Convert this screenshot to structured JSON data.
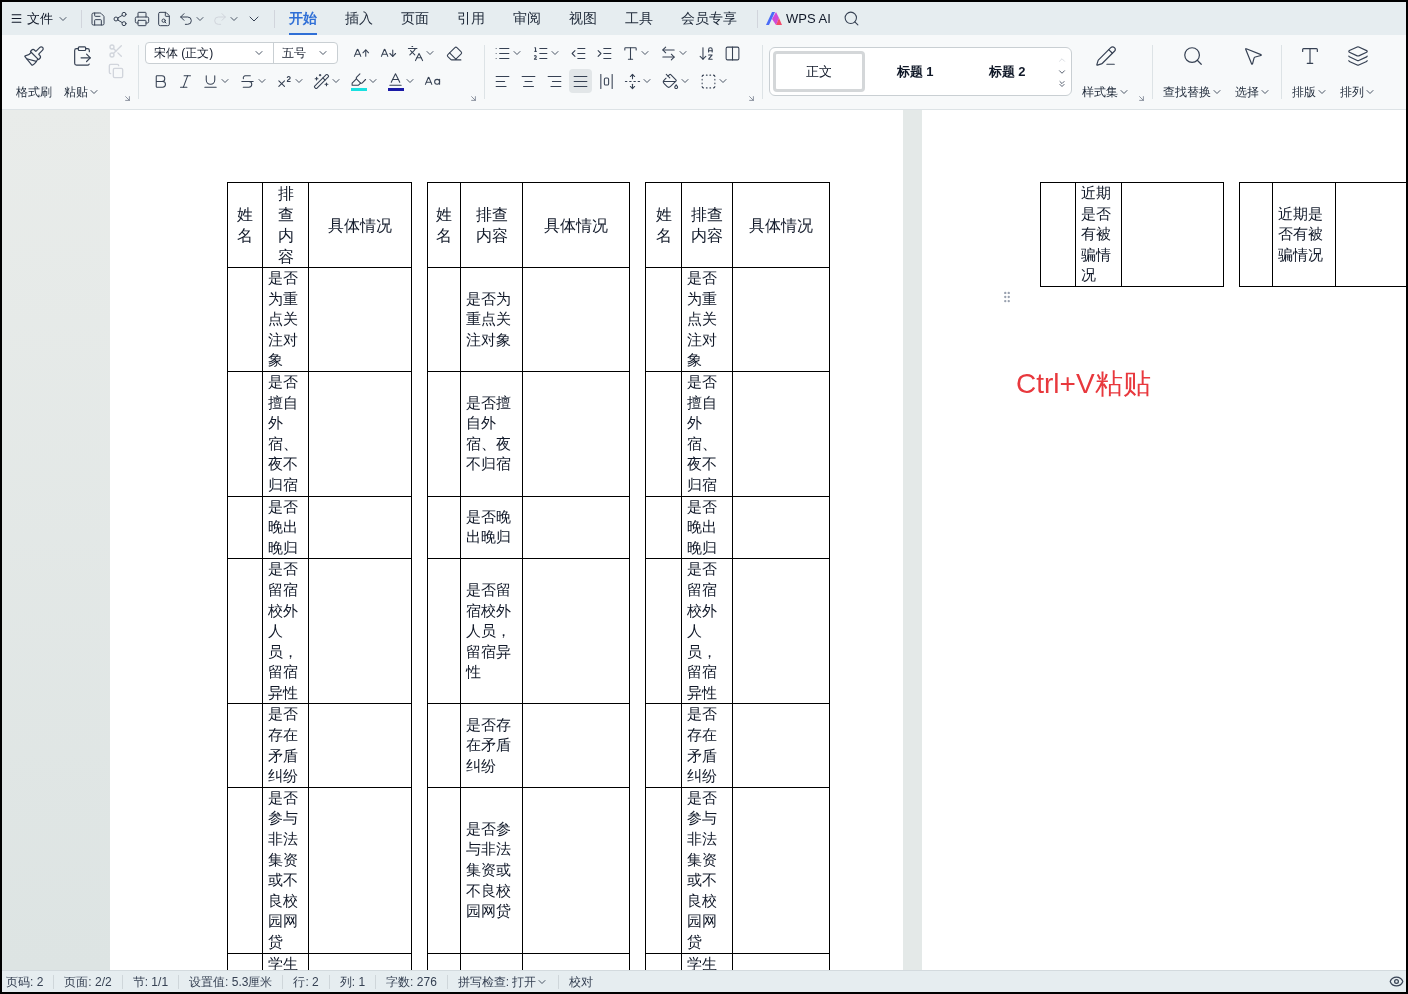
{
  "menu": {
    "label": "文件"
  },
  "quick_access": {
    "redo": {
      "disabled": true
    }
  },
  "ribbon_tabs": [
    {
      "label": "开始",
      "selected": true
    },
    {
      "label": "插入",
      "selected": false
    },
    {
      "label": "页面",
      "selected": false
    },
    {
      "label": "引用",
      "selected": false
    },
    {
      "label": "审阅",
      "selected": false
    },
    {
      "label": "视图",
      "selected": false
    },
    {
      "label": "工具",
      "selected": false
    },
    {
      "label": "会员专享",
      "selected": false
    }
  ],
  "wps_ai": "WPS AI",
  "ribbon": {
    "format_painter": "格式刷",
    "paste": "粘贴",
    "cut": {
      "disabled": true
    },
    "copy": {
      "disabled": true
    },
    "font_name": "宋体 (正文)",
    "font_size": "五号",
    "styles": [
      {
        "label": "正文",
        "selected": true
      },
      {
        "label": "标题 1",
        "selected": false
      },
      {
        "label": "标题 2",
        "selected": false
      }
    ],
    "style_set": "样式集",
    "find_replace": "查找替换",
    "select": "选择",
    "layout": "排版",
    "arrange": "排列"
  },
  "page1": {
    "tables": [
      {
        "header": [
          "姓名",
          "排查内容",
          "具体情况"
        ],
        "items": [
          "是否为重点关注对象",
          "是否擅自外宿、夜不归宿",
          "是否晚出晚归",
          "是否留宿校外人员，留宿异性",
          "是否存在矛盾纠纷",
          "是否参与非法集资或不良校园网贷",
          "学生"
        ]
      },
      {
        "header": [
          "姓名",
          "排查内容",
          "具体情况"
        ],
        "items": [
          "是否为重点关注对象",
          "是否擅自外宿、夜不归宿",
          "是否晚出晚归",
          "是否留宿校外人员，留宿异性",
          "是否存在矛盾纠纷",
          "是否参与非法集资或不良校园网贷"
        ]
      },
      {
        "header": [
          "姓名",
          "排查内容",
          "具体情况"
        ],
        "items": [
          "是否为重点关注对象",
          "是否擅自外宿、夜不归宿",
          "是否晚出晚归",
          "是否留宿校外人员，留宿异性",
          "是否存在矛盾纠纷",
          "是否参与非法集资或不良校园网贷",
          "学生"
        ]
      }
    ]
  },
  "page2": {
    "tables": [
      {
        "items": [
          "近期是否有被骗情况"
        ]
      },
      {
        "items": [
          "近期是否有被骗情况"
        ]
      }
    ],
    "paste_hint": "Ctrl+V粘贴"
  },
  "status_bar": [
    {
      "text": "页码: 2",
      "dropdown": false
    },
    {
      "text": "页面: 2/2",
      "dropdown": false
    },
    {
      "text": "节: 1/1",
      "dropdown": false
    },
    {
      "text": "设置值: 5.3厘米",
      "dropdown": false
    },
    {
      "text": "行: 2",
      "dropdown": false
    },
    {
      "text": "列: 1",
      "dropdown": false
    },
    {
      "text": "字数: 276",
      "dropdown": false
    },
    {
      "text": "拼写检查: 打开",
      "dropdown": true
    },
    {
      "text": "校对",
      "dropdown": false
    }
  ]
}
